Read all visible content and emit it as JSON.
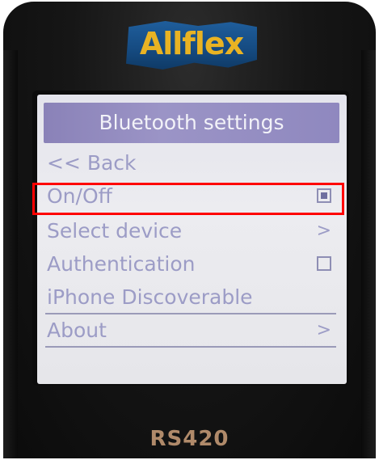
{
  "device": {
    "brand": "Allflex",
    "model": "RS420"
  },
  "screen": {
    "title": "Bluetooth settings",
    "items": [
      {
        "label": "<< Back",
        "control": "none"
      },
      {
        "label": "On/Off",
        "control": "checkbox",
        "checked": true,
        "highlighted": true
      },
      {
        "label": "Select device",
        "control": "chevron",
        "chevron": ">"
      },
      {
        "label": "Authentication",
        "control": "checkbox",
        "checked": false
      },
      {
        "label": "iPhone Discoverable",
        "control": "none"
      },
      {
        "label": "About",
        "control": "chevron",
        "chevron": ">"
      }
    ]
  },
  "colors": {
    "highlight_box": "#ff0000",
    "title_bar": "#8f88bf",
    "logo_text": "#e9b323",
    "logo_banner": "#1f5e9c"
  }
}
